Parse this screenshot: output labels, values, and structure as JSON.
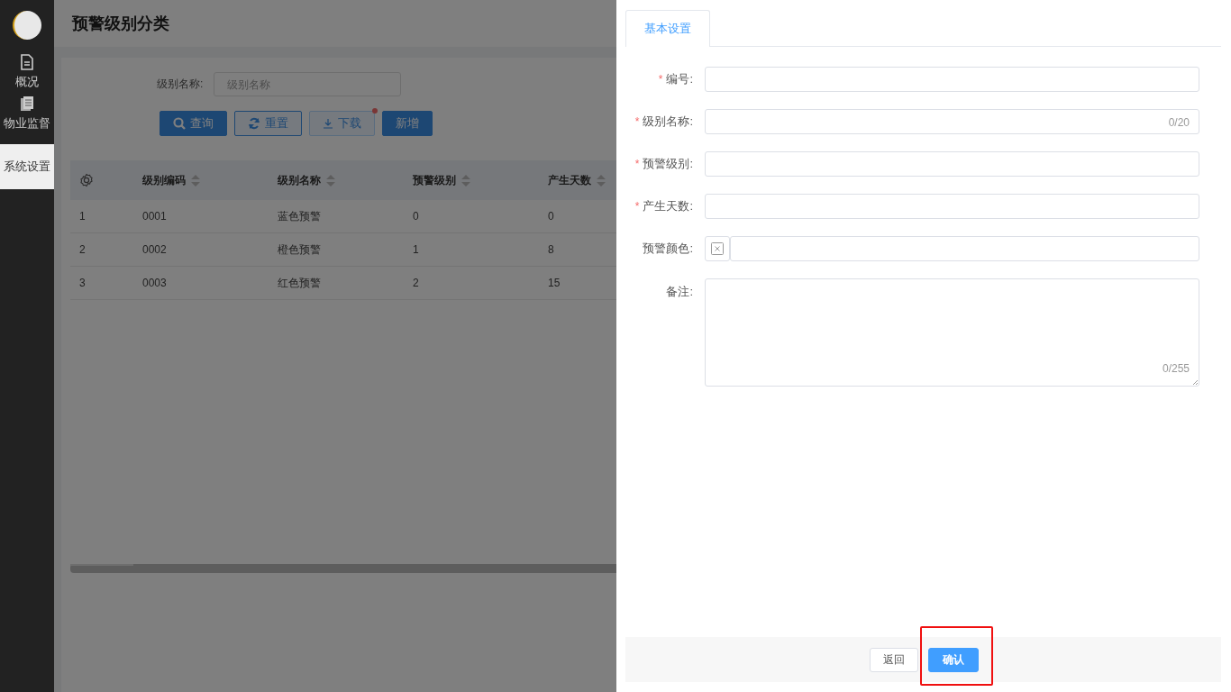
{
  "sidebar": {
    "items": [
      {
        "label": "概况",
        "kind": "file",
        "selected": false
      },
      {
        "label": "物业监督",
        "kind": "pages",
        "selected": false
      },
      {
        "label": "系统设置",
        "kind": "plain",
        "selected": true
      }
    ]
  },
  "page_title": "预警级别分类",
  "filter": {
    "label": "级别名称:",
    "placeholder": "级别名称"
  },
  "toolbar": [
    {
      "label": "查询",
      "kind": "search",
      "dot": false
    },
    {
      "label": "重置",
      "kind": "reset",
      "dot": false
    },
    {
      "label": "下载",
      "kind": "download",
      "dot": true
    },
    {
      "label": "新增",
      "kind": "add",
      "dot": false
    }
  ],
  "table": {
    "columns": [
      "",
      "级别编码",
      "级别名称",
      "预警级别",
      "产生天数"
    ],
    "rows": [
      [
        "1",
        "0001",
        "蓝色预警",
        "0",
        "0"
      ],
      [
        "2",
        "0002",
        "橙色预警",
        "1",
        "8"
      ],
      [
        "3",
        "0003",
        "红色预警",
        "2",
        "15"
      ]
    ]
  },
  "drawer": {
    "tabs": [
      {
        "label": "基本设置",
        "selected": true
      }
    ],
    "fields": [
      {
        "label": "编号:",
        "required_mark": "*",
        "kind": "input"
      },
      {
        "label": "级别名称:",
        "required_mark": "*",
        "kind": "input",
        "counter": "0/20"
      },
      {
        "label": "预警级别:",
        "required_mark": "*",
        "kind": "input"
      },
      {
        "label": "产生天数:",
        "required_mark": "*",
        "kind": "input"
      },
      {
        "label": "预警颜色:",
        "kind": "color"
      },
      {
        "label": "备注:",
        "kind": "textarea",
        "counter": "0/255"
      }
    ],
    "buttons": [
      {
        "label": "返回",
        "kind": "default",
        "highlighted": false
      },
      {
        "label": "确认",
        "kind": "primary",
        "highlighted": true
      }
    ]
  }
}
